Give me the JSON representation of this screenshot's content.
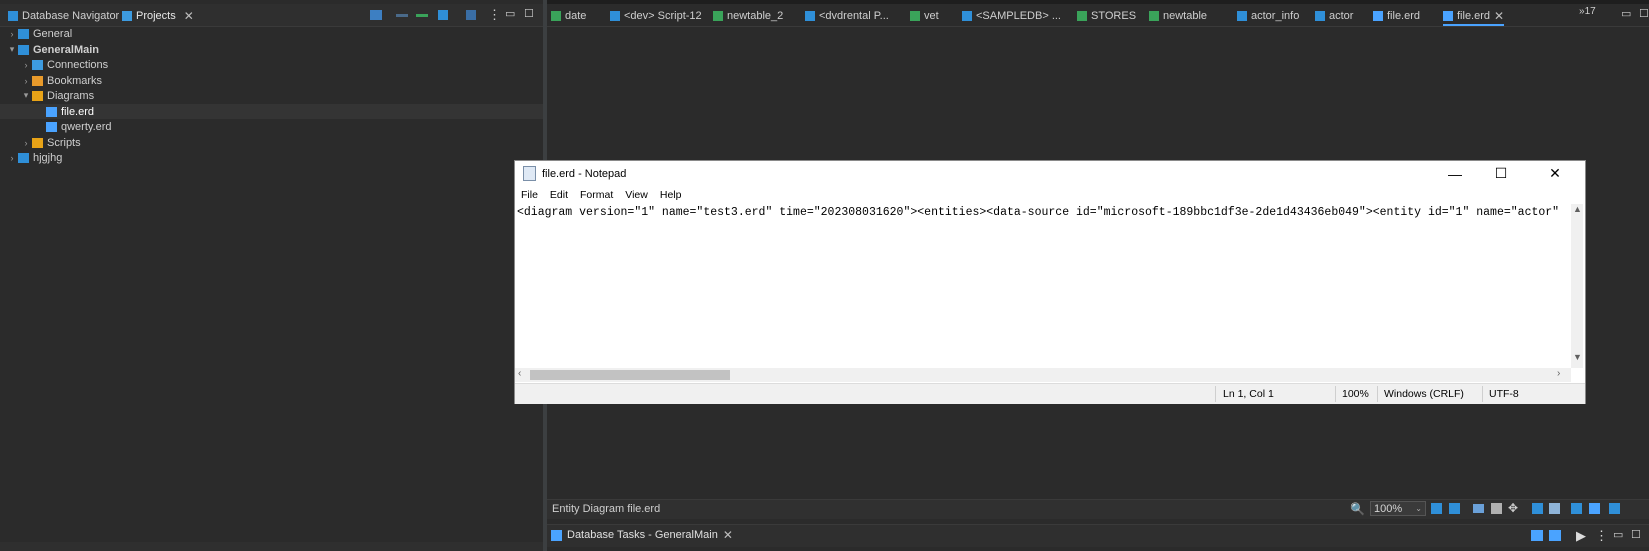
{
  "left": {
    "tabs": [
      {
        "label": "Database Navigator"
      },
      {
        "label": "Projects"
      }
    ],
    "tree": [
      {
        "label": "General",
        "level": 0,
        "expanded": false,
        "icon": "project-icon",
        "color": "#2f8fd8"
      },
      {
        "label": "GeneralMain",
        "level": 0,
        "expanded": true,
        "icon": "project-icon",
        "color": "#2f8fd8"
      },
      {
        "label": "Connections",
        "level": 1,
        "expanded": false,
        "icon": "connections-icon",
        "color": "#3d9be0"
      },
      {
        "label": "Bookmarks",
        "level": 1,
        "expanded": false,
        "icon": "bookmarks-icon",
        "color": "#e89a2b"
      },
      {
        "label": "Diagrams",
        "level": 1,
        "expanded": true,
        "icon": "folder-icon",
        "color": "#e8a317"
      },
      {
        "label": "file.erd",
        "level": 2,
        "selected": true,
        "icon": "erd-icon",
        "color": "#4aa3ff"
      },
      {
        "label": "qwerty.erd",
        "level": 2,
        "icon": "erd-icon",
        "color": "#4aa3ff"
      },
      {
        "label": "Scripts",
        "level": 1,
        "expanded": false,
        "icon": "folder-icon",
        "color": "#e8a317"
      },
      {
        "label": "hjgjhg",
        "level": 0,
        "expanded": false,
        "icon": "project-icon",
        "color": "#2f8fd8"
      }
    ]
  },
  "editor": {
    "tabs": [
      {
        "label": "date"
      },
      {
        "label": "<dev> Script-12"
      },
      {
        "label": "newtable_2"
      },
      {
        "label": "<dvdrental P..."
      },
      {
        "label": "vet"
      },
      {
        "label": "<SAMPLEDB> ..."
      },
      {
        "label": "STORES"
      },
      {
        "label": "newtable"
      },
      {
        "label": "actor_info"
      },
      {
        "label": "actor"
      },
      {
        "label": "file.erd"
      },
      {
        "label": "file.erd",
        "active": true
      }
    ],
    "overflow_count": "17",
    "status_label": "Entity Diagram  file.erd",
    "zoom": "100%"
  },
  "notepad": {
    "title": "file.erd - Notepad",
    "menu": [
      "File",
      "Edit",
      "Format",
      "View",
      "Help"
    ],
    "content": "<diagram version=\"1\" name=\"test3.erd\" time=\"202308031620\"><entities><data-source id=\"microsoft-189bbc1df3e-2de1d43436eb049\"><entity id=\"1\" name=\"actor\"",
    "status": {
      "position": "Ln 1, Col 1",
      "zoom": "100%",
      "line_ending": "Windows (CRLF)",
      "encoding": "UTF-8"
    }
  },
  "bottom": {
    "tasks_label": "Database Tasks - GeneralMain"
  }
}
